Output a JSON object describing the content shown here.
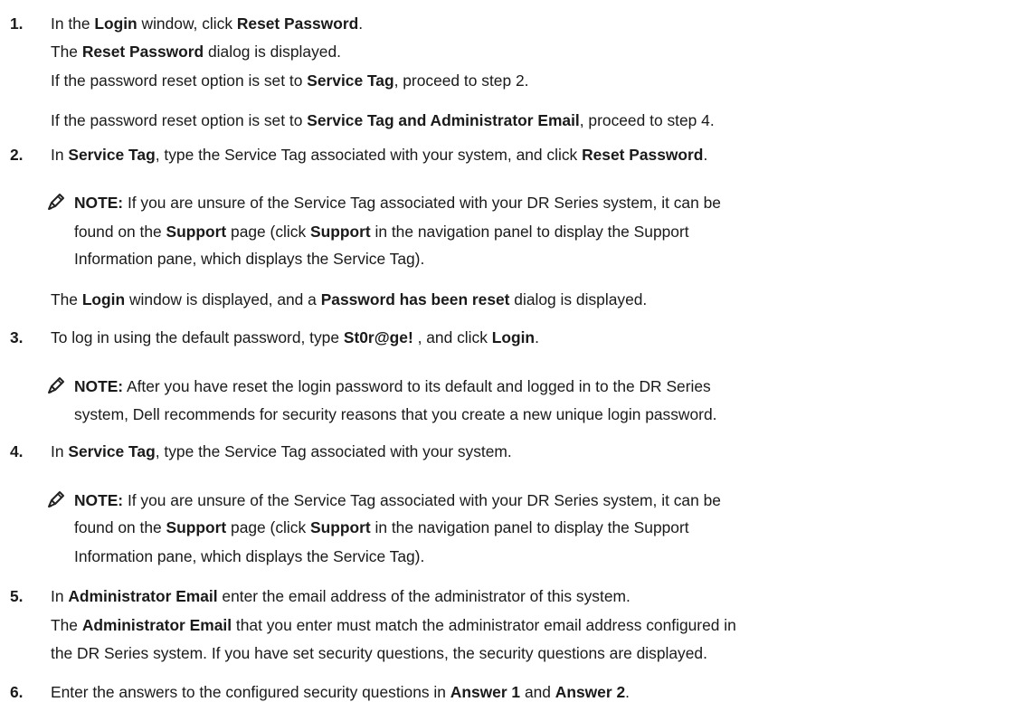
{
  "steps": [
    {
      "num": "1.",
      "lines": [
        [
          {
            "t": "In the "
          },
          {
            "t": "Login",
            "b": true
          },
          {
            "t": " window, click "
          },
          {
            "t": "Reset Password",
            "b": true
          },
          {
            "t": "."
          }
        ],
        [
          {
            "t": "The "
          },
          {
            "t": "Reset Password",
            "b": true
          },
          {
            "t": " dialog is displayed."
          }
        ],
        [
          {
            "t": "If the password reset option is set to "
          },
          {
            "t": "Service Tag",
            "b": true
          },
          {
            "t": ", proceed to step 2."
          }
        ],
        [
          {
            "t": "If the password reset option is set to "
          },
          {
            "t": "Service Tag and Administrator Email",
            "b": true
          },
          {
            "t": ", proceed to step 4."
          }
        ]
      ]
    },
    {
      "num": "2.",
      "lines": [
        [
          {
            "t": "In "
          },
          {
            "t": "Service Tag",
            "b": true
          },
          {
            "t": ", type the Service Tag associated with your system, and click "
          },
          {
            "t": "Reset Password",
            "b": true
          },
          {
            "t": "."
          }
        ]
      ],
      "note": [
        [
          {
            "t": "NOTE:",
            "b": true
          },
          {
            "t": " If you are unsure of the Service Tag associated with your DR Series system, it can be"
          }
        ],
        [
          {
            "t": "found on the "
          },
          {
            "t": "Support",
            "b": true
          },
          {
            "t": " page (click "
          },
          {
            "t": "Support",
            "b": true
          },
          {
            "t": " in the navigation panel to display the Support"
          }
        ],
        [
          {
            "t": "Information pane, which displays the Service Tag)."
          }
        ]
      ],
      "after": [
        [
          {
            "t": "The "
          },
          {
            "t": "Login",
            "b": true
          },
          {
            "t": " window is displayed, and a "
          },
          {
            "t": "Password has been reset",
            "b": true
          },
          {
            "t": " dialog is displayed."
          }
        ]
      ]
    },
    {
      "num": "3.",
      "lines": [
        [
          {
            "t": "To log in using the default password, type "
          },
          {
            "t": "St0r@ge!",
            "b": true
          },
          {
            "t": " , and click "
          },
          {
            "t": "Login",
            "b": true
          },
          {
            "t": "."
          }
        ]
      ],
      "note": [
        [
          {
            "t": "NOTE:",
            "b": true
          },
          {
            "t": " After you have reset the login password to its default and logged in to the DR Series"
          }
        ],
        [
          {
            "t": "system, Dell recommends for security reasons that you create a new unique login password."
          }
        ]
      ]
    },
    {
      "num": "4.",
      "lines": [
        [
          {
            "t": "In "
          },
          {
            "t": "Service Tag",
            "b": true
          },
          {
            "t": ", type the Service Tag associated with your system."
          }
        ]
      ],
      "note": [
        [
          {
            "t": "NOTE:",
            "b": true
          },
          {
            "t": " If you are unsure of the Service Tag associated with your DR Series system, it can be"
          }
        ],
        [
          {
            "t": "found on the "
          },
          {
            "t": "Support",
            "b": true
          },
          {
            "t": " page (click "
          },
          {
            "t": "Support",
            "b": true
          },
          {
            "t": " in the navigation panel to display the Support"
          }
        ],
        [
          {
            "t": "Information pane, which displays the Service Tag)."
          }
        ]
      ]
    },
    {
      "num": "5.",
      "lines": [
        [
          {
            "t": "In "
          },
          {
            "t": "Administrator Email",
            "b": true
          },
          {
            "t": " enter the email address of the administrator of this system."
          }
        ],
        [
          {
            "t": "The "
          },
          {
            "t": "Administrator Email",
            "b": true
          },
          {
            "t": " that you enter must match the administrator email address configured in"
          }
        ],
        [
          {
            "t": "the DR Series system. If you have set security questions, the security questions are displayed."
          }
        ]
      ]
    },
    {
      "num": "6.",
      "lines": [
        [
          {
            "t": "Enter the answers to the configured security questions in "
          },
          {
            "t": "Answer 1",
            "b": true
          },
          {
            "t": " and "
          },
          {
            "t": "Answer 2",
            "b": true
          },
          {
            "t": "."
          }
        ]
      ]
    }
  ]
}
